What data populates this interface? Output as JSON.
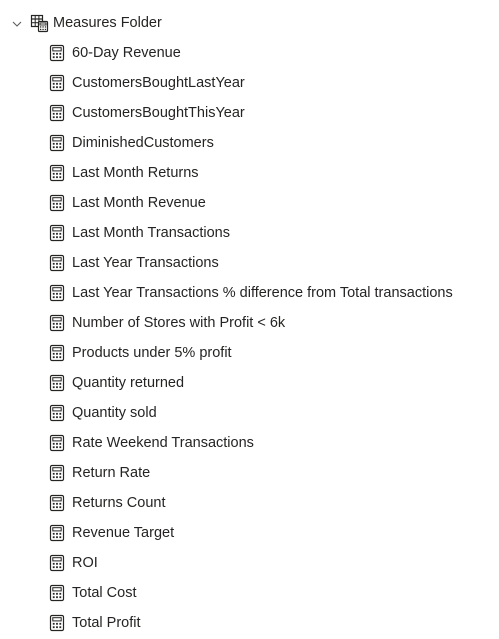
{
  "tree": {
    "folder": {
      "label": "Measures Folder",
      "icon": "table-folder-icon",
      "expanded": true
    },
    "measure_icon": "calculator-icon",
    "measures": [
      "60-Day Revenue",
      "CustomersBoughtLastYear",
      "CustomersBoughtThisYear",
      "DiminishedCustomers",
      "Last Month Returns",
      "Last Month Revenue",
      "Last Month Transactions",
      "Last Year Transactions",
      "Last Year Transactions % difference from Total transactions",
      "Number of Stores with Profit < 6k",
      "Products under 5% profit",
      "Quantity returned",
      "Quantity sold",
      "Rate Weekend Transactions",
      "Return Rate",
      "Returns Count",
      "Revenue Target",
      "ROI",
      "Total Cost",
      "Total Profit"
    ]
  }
}
